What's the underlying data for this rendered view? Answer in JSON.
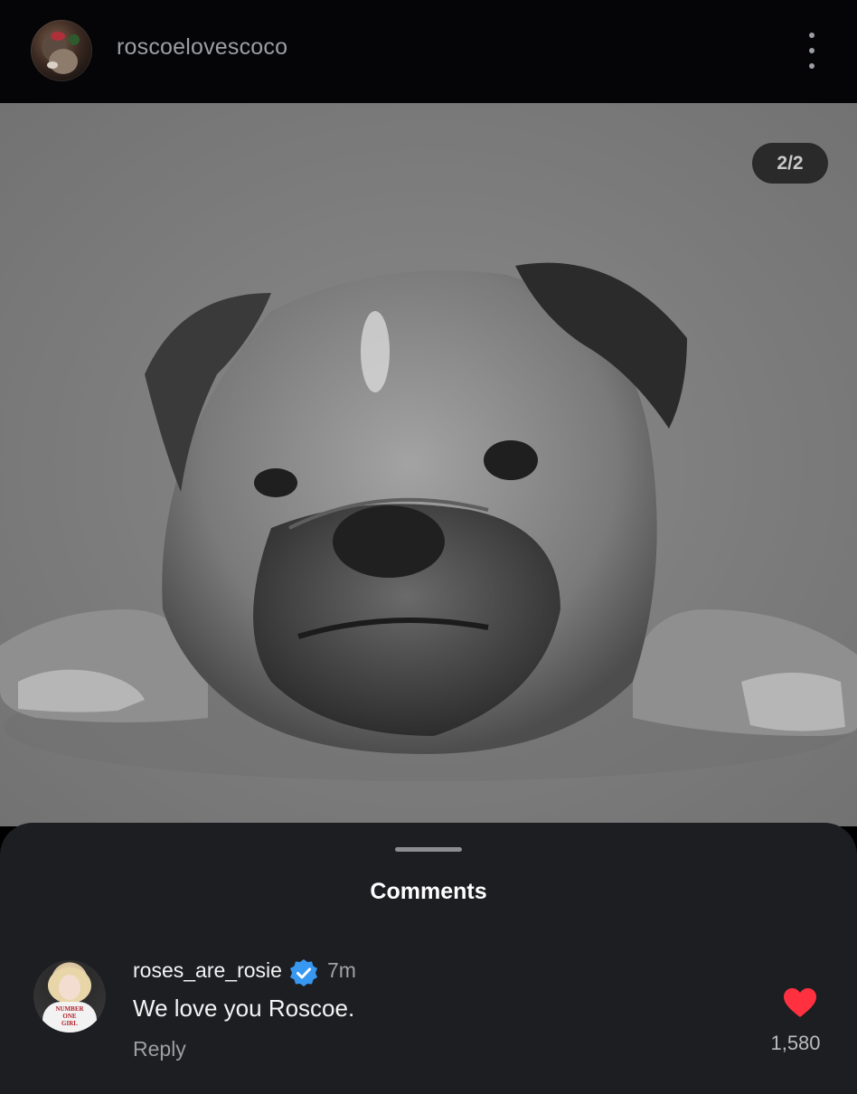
{
  "header": {
    "username": "roscoelovescoco",
    "more_icon": "more-vertical-icon"
  },
  "post": {
    "image": "bulldog-photo",
    "counter": "2/2"
  },
  "comments_sheet": {
    "title": "Comments",
    "comments": [
      {
        "username": "roses_are_rosie",
        "verified_icon": "verified-badge-icon",
        "time": "7m",
        "text": "We love you Roscoe.",
        "reply_label": "Reply",
        "likes": "1,580",
        "liked": true,
        "avatar_shirt_text": [
          "NUMBER",
          "ONE",
          "GIRL"
        ]
      }
    ]
  },
  "colors": {
    "background": "#000000",
    "header": "#050507",
    "sheet": "#1d1e22",
    "heart": "#ff3040",
    "verified": "#3897f0"
  }
}
